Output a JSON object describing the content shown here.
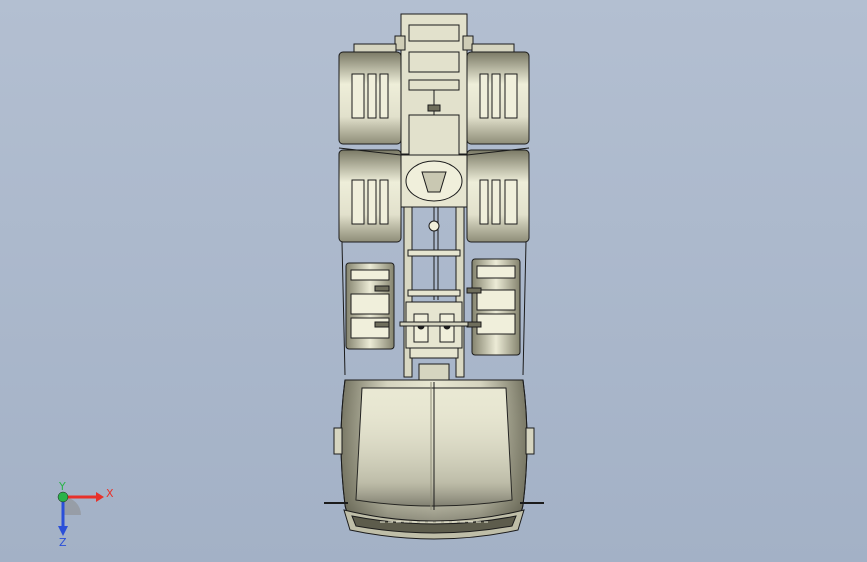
{
  "viewport": {
    "model": "truck-chassis-top-view",
    "background_top": "#b3bfd1",
    "background_bottom": "#a3b1c6",
    "body_fill": "#e2e1cc",
    "shade_fill": "#a8a892",
    "line_color": "#1b1b1b"
  },
  "triad": {
    "x_label": "X",
    "y_label": "Y",
    "z_label": "Z",
    "x_color": "#e8312a",
    "y_color": "#2bb34a",
    "z_color": "#2a4fd9"
  }
}
